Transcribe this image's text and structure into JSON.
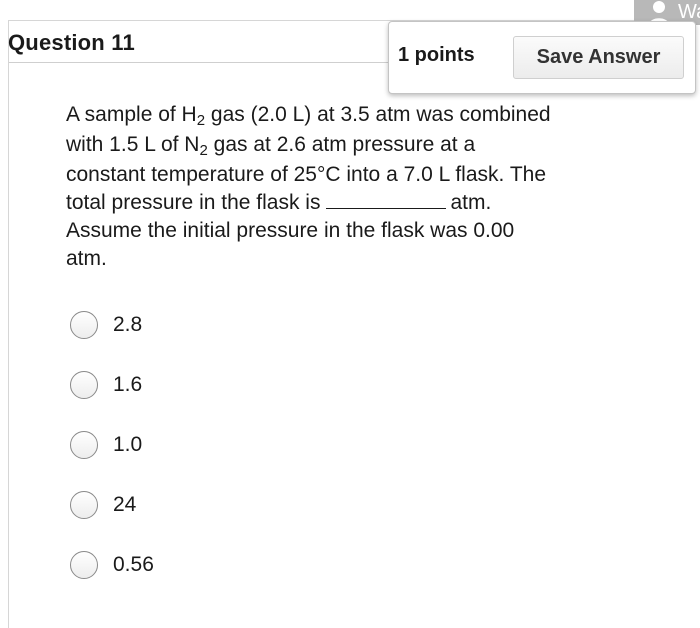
{
  "header": {
    "question_title": "Question 11",
    "points_label": "1 points",
    "save_label": "Save Answer",
    "badge_text": "Wa"
  },
  "question": {
    "line1_a": "A sample of H",
    "line1_sub": "2",
    "line1_b": " gas (2.0 L) at 3.5 atm was combined",
    "line2_a": "with 1.5 L of N",
    "line2_sub": "2",
    "line2_b": " gas at 2.6 atm pressure at a",
    "line3": "constant temperature of 25°C into a 7.0 L flask. The",
    "line4_a": "total pressure in the flask is",
    "line4_b": "atm.",
    "line5": "Assume the initial pressure in the flask was 0.00",
    "line6": "atm."
  },
  "options": [
    {
      "label": "2.8"
    },
    {
      "label": "1.6"
    },
    {
      "label": "1.0"
    },
    {
      "label": "24"
    },
    {
      "label": "0.56"
    }
  ]
}
